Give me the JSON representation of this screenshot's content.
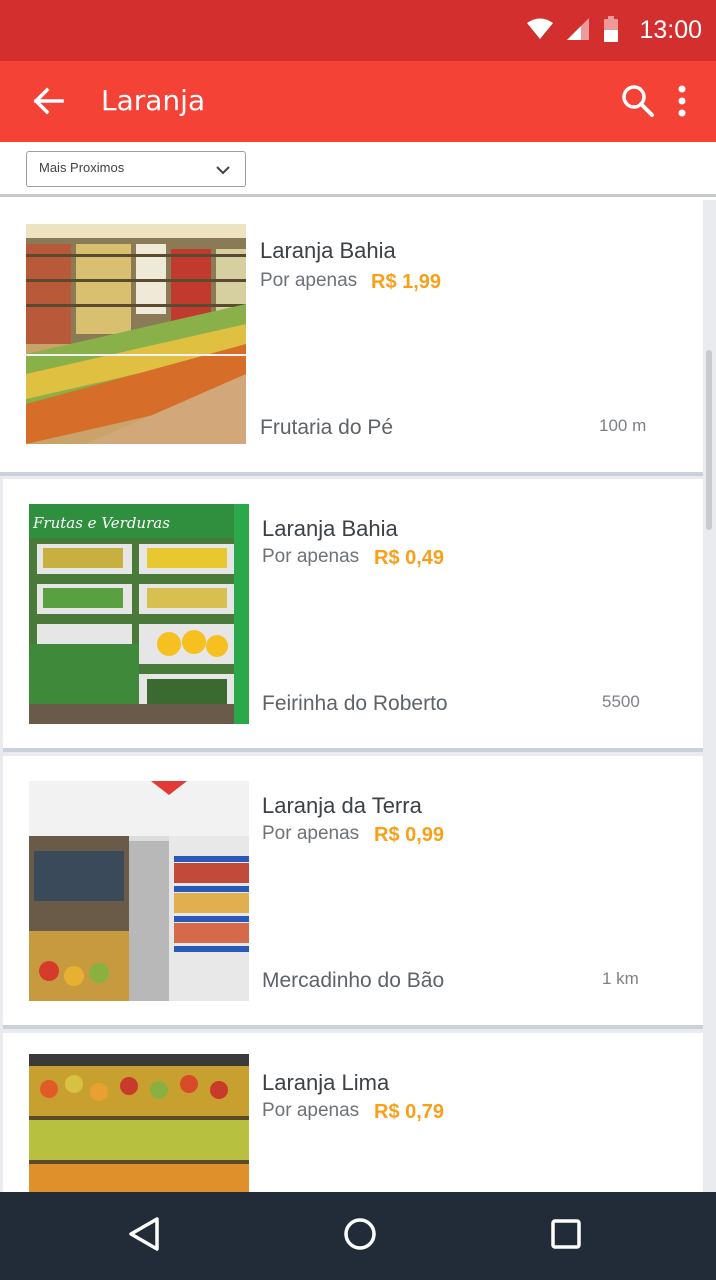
{
  "status_bar": {
    "time": "13:00"
  },
  "app_bar": {
    "title": "Laranja"
  },
  "filter": {
    "selected": "Mais Proximos"
  },
  "colors": {
    "status_bar": "#d32f2f",
    "app_bar": "#f44336",
    "price": "#f9a01b",
    "nav_bar": "#222b38"
  },
  "icons": {
    "back": "arrow-back-icon",
    "search": "search-icon",
    "more": "more-vert-icon",
    "dropdown": "chevron-down-icon"
  },
  "products": [
    {
      "name": "Laranja Bahia",
      "price_prefix": "Por apenas",
      "price": "R$ 1,99",
      "store": "Frutaria do Pé",
      "distance": "100 m"
    },
    {
      "name": "Laranja Bahia",
      "price_prefix": "Por apenas",
      "price": "R$ 0,49",
      "store": "Feirinha do Roberto",
      "distance": "5500"
    },
    {
      "name": "Laranja da Terra",
      "price_prefix": "Por apenas",
      "price": "R$ 0,99",
      "store": "Mercadinho do Bão",
      "distance": "1 km"
    },
    {
      "name": "Laranja Lima",
      "price_prefix": "Por apenas",
      "price": "R$ 0,79",
      "store": "",
      "distance": ""
    }
  ],
  "nav": {
    "back": "nav-back-icon",
    "home": "nav-home-icon",
    "recents": "nav-recents-icon"
  },
  "photo_sign": "Frutas e Verduras"
}
